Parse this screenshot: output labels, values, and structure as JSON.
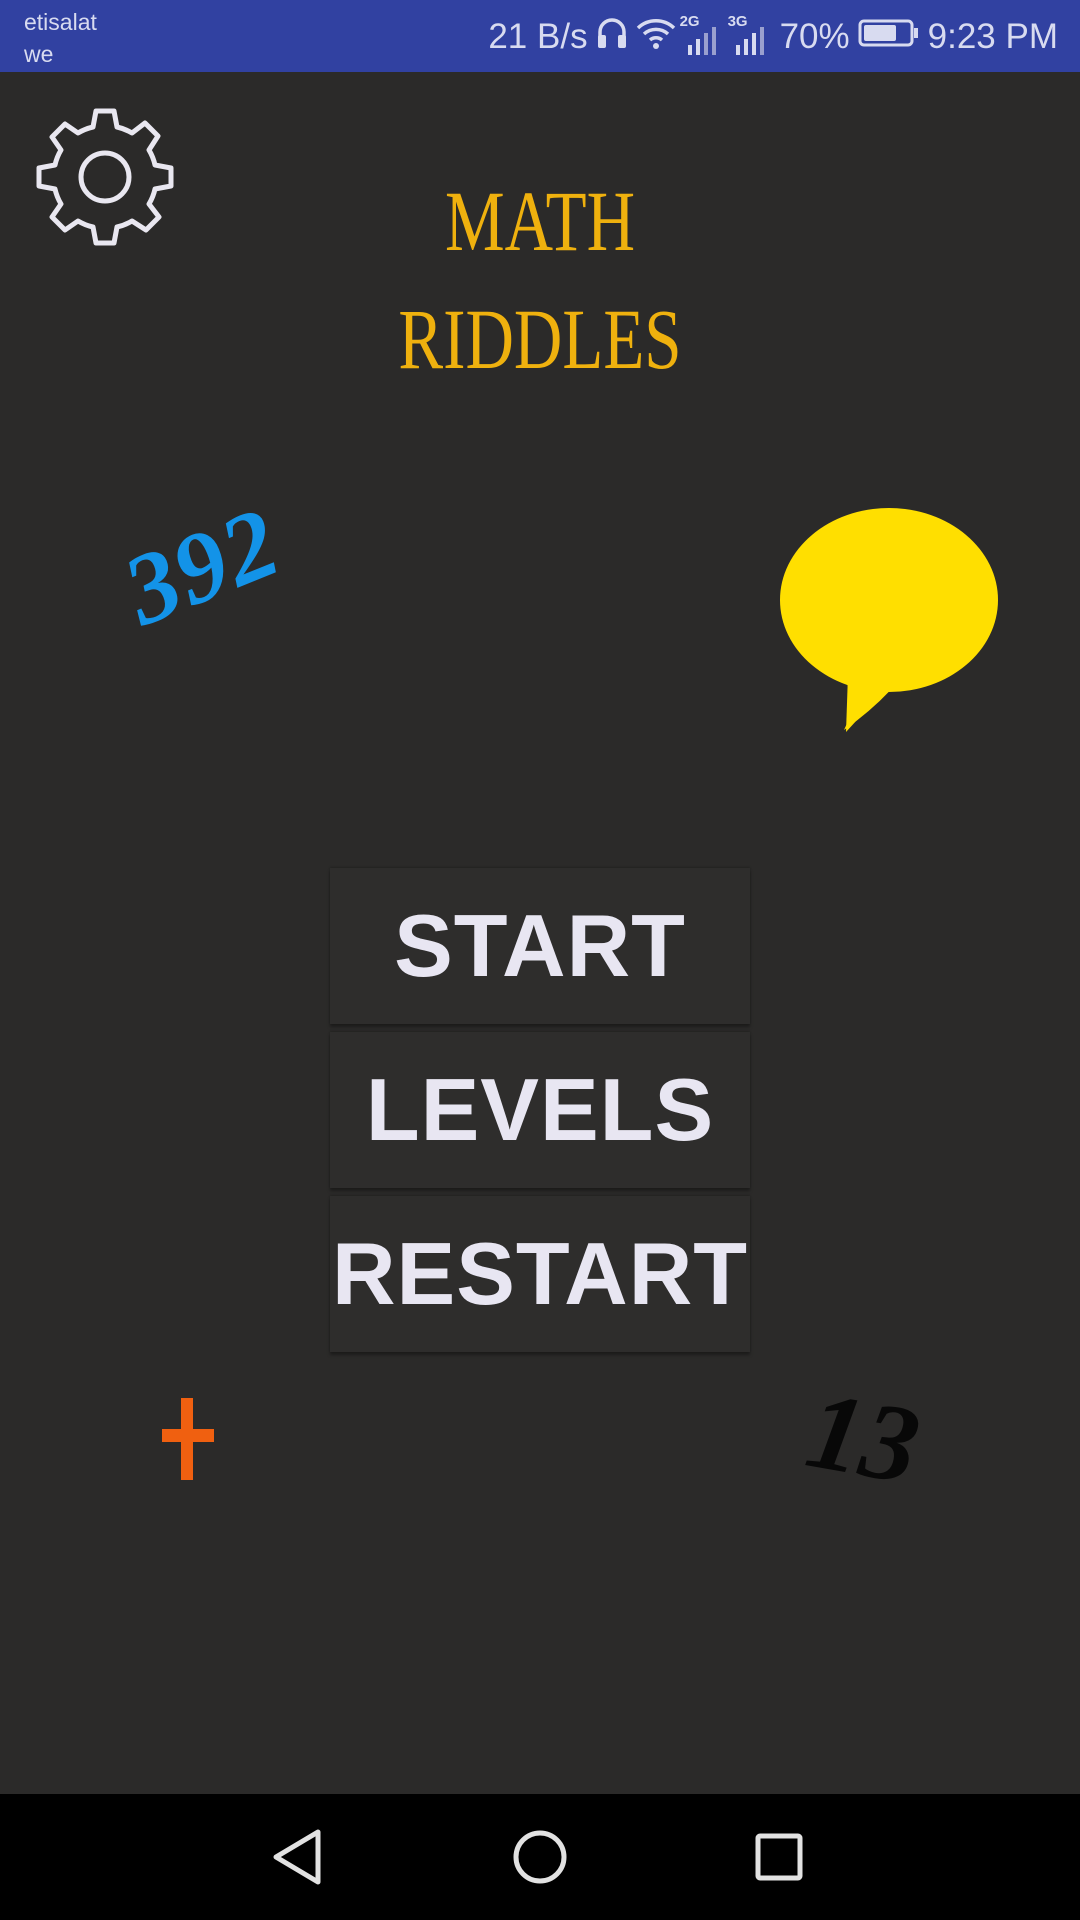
{
  "status_bar": {
    "carrier_line1": "etisalat",
    "carrier_line2": "we",
    "net_speed": "21 B/s",
    "signal1_tag": "2G",
    "signal2_tag": "3G",
    "battery": "70%",
    "time": "9:23 PM",
    "icons": [
      "headphones-icon",
      "wifi-icon",
      "signal-icon",
      "battery-icon"
    ],
    "background": "#3141a1"
  },
  "app": {
    "title_line1": "MATH",
    "title_line2": "RIDDLES",
    "title_color": "#efb10e",
    "background": "#2b2a29"
  },
  "decorations": {
    "number_top": "392",
    "number_top_color": "#1393e8",
    "plus_sign_color": "#f06010",
    "number_bottom": "13",
    "bubble_color": "#ffdf00"
  },
  "menu": {
    "start_label": "START",
    "levels_label": "LEVELS",
    "restart_label": "RESTART",
    "label_color": "#e8e6f2"
  },
  "nav_bar": {
    "icons": [
      "back-icon",
      "home-icon",
      "recents-icon"
    ]
  }
}
